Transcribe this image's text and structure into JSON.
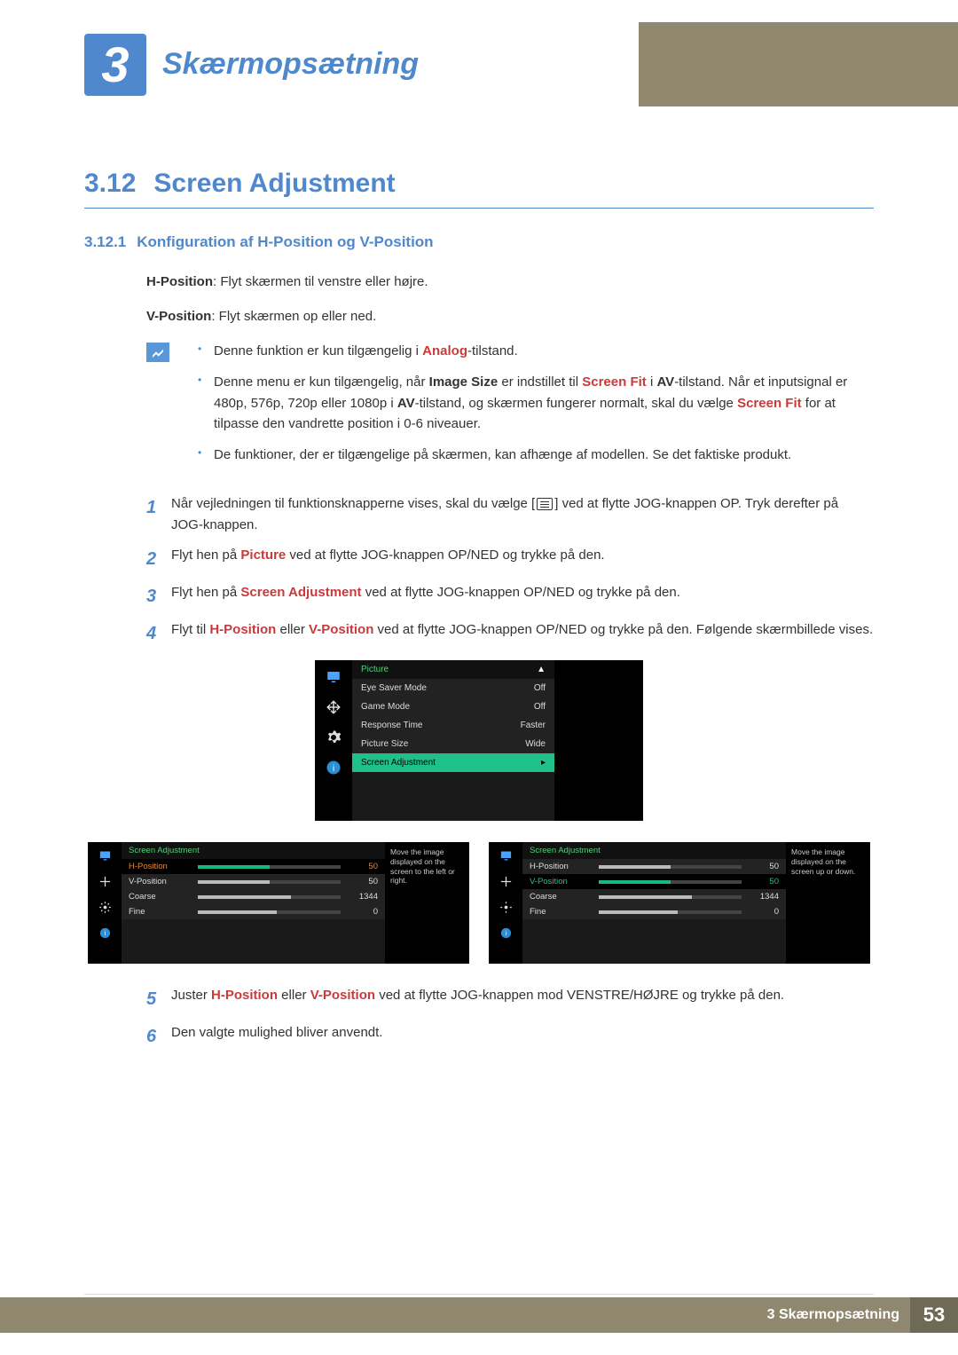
{
  "chapter": {
    "number": "3",
    "title": "Skærmopsætning"
  },
  "section": {
    "number": "3.12",
    "title": "Screen Adjustment"
  },
  "subsection": {
    "number": "3.12.1",
    "title": "Konfiguration af H-Position og V-Position"
  },
  "hpos": {
    "label": "H-Position",
    "desc": ": Flyt skærmen til venstre eller højre."
  },
  "vpos": {
    "label": "V-Position",
    "desc": ": Flyt skærmen op eller ned."
  },
  "notes": {
    "n1a": "Denne funktion er kun tilgængelig i ",
    "n1b": "Analog",
    "n1c": "-tilstand.",
    "n2a": "Denne menu er kun tilgængelig, når ",
    "n2b": "Image Size",
    "n2c": " er indstillet til ",
    "n2d": "Screen Fit",
    "n2e": " i ",
    "n2f": "AV",
    "n2g": "-tilstand. Når et inputsignal er 480p, 576p, 720p eller 1080p i ",
    "n2h": "AV",
    "n2i": "-tilstand, og skærmen fungerer normalt, skal du vælge ",
    "n2j": "Screen Fit",
    "n2k": " for at tilpasse den vandrette position i 0-6 niveauer.",
    "n3": "De funktioner, der er tilgængelige på skærmen, kan afhænge af modellen. Se det faktiske produkt."
  },
  "steps": {
    "s1a": "Når vejledningen til funktionsknapperne vises, skal du vælge [",
    "s1b": "] ved at flytte JOG-knappen OP. Tryk derefter på JOG-knappen.",
    "s2a": "Flyt hen på ",
    "s2b": "Picture",
    "s2c": " ved at flytte JOG-knappen OP/NED og trykke på den.",
    "s3a": "Flyt hen på ",
    "s3b": "Screen Adjustment",
    "s3c": " ved at flytte JOG-knappen OP/NED og trykke på den.",
    "s4a": "Flyt til ",
    "s4b": "H-Position",
    "s4c": " eller ",
    "s4d": "V-Position",
    "s4e": " ved at flytte JOG-knappen OP/NED og trykke på den. Følgende skærmbillede vises.",
    "s5a": "Juster ",
    "s5b": "H-Position",
    "s5c": " eller ",
    "s5d": "V-Position",
    "s5e": " ved at flytte JOG-knappen mod VENSTRE/HØJRE og trykke på den.",
    "s6": "Den valgte mulighed bliver anvendt."
  },
  "osd1": {
    "title": "Picture",
    "arrow": "▲",
    "items": [
      {
        "label": "Eye Saver Mode",
        "value": "Off"
      },
      {
        "label": "Game Mode",
        "value": "Off"
      },
      {
        "label": "Response Time",
        "value": "Faster"
      },
      {
        "label": "Picture Size",
        "value": "Wide"
      }
    ],
    "selected": {
      "label": "Screen Adjustment",
      "value": "▸"
    }
  },
  "osd2": {
    "title": "Screen Adjustment",
    "tip": "Move the image displayed on the screen to the left or right.",
    "rows": [
      {
        "label": "H-Position",
        "value": "50",
        "pct": 50,
        "sel": true
      },
      {
        "label": "V-Position",
        "value": "50",
        "pct": 50,
        "sel": false
      },
      {
        "label": "Coarse",
        "value": "1344",
        "pct": 65,
        "sel": false
      },
      {
        "label": "Fine",
        "value": "0",
        "pct": 55,
        "sel": false
      }
    ]
  },
  "osd3": {
    "title": "Screen Adjustment",
    "tip": "Move the image displayed on the screen up or down.",
    "rows": [
      {
        "label": "H-Position",
        "value": "50",
        "pct": 50,
        "sel": false
      },
      {
        "label": "V-Position",
        "value": "50",
        "pct": 50,
        "sel": true
      },
      {
        "label": "Coarse",
        "value": "1344",
        "pct": 65,
        "sel": false
      },
      {
        "label": "Fine",
        "value": "0",
        "pct": 55,
        "sel": false
      }
    ]
  },
  "footer": {
    "section": "3 Skærmopsætning",
    "page": "53"
  },
  "numerals": {
    "n1": "1",
    "n2": "2",
    "n3": "3",
    "n4": "4",
    "n5": "5",
    "n6": "6"
  }
}
